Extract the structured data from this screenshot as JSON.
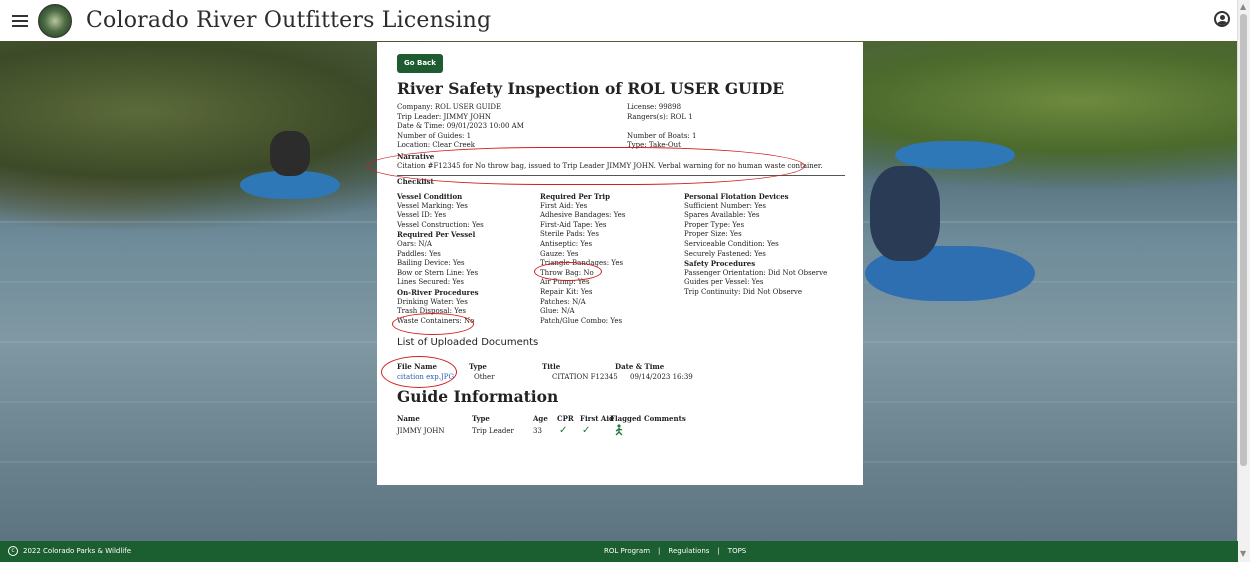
{
  "app": {
    "title": "Colorado River Outfitters Licensing"
  },
  "actions": {
    "go_back": "Go Back"
  },
  "inspection": {
    "title": "River Safety Inspection of ROL USER GUIDE",
    "left_info": [
      "Company: ROL USER GUIDE",
      "Trip Leader: JIMMY JOHN",
      "Date & Time: 09/01/2023 10:00 AM",
      "Number of Guides: 1",
      "Location: Clear Creek"
    ],
    "right_info": [
      "License: 99898",
      "Rangers(s): ROL 1",
      "",
      "Number of Boats: 1",
      "Type: Take-Out"
    ],
    "narrative_label": "Narrative",
    "narrative": "Citation #F12345 for No throw bag, issued to Trip Leader JIMMY JOHN. Verbal warning for no human waste container.",
    "checklist_label": "Checklist"
  },
  "checklist": {
    "col1": [
      {
        "t": "Vessel Condition",
        "b": true
      },
      {
        "t": "Vessel Marking: Yes"
      },
      {
        "t": "Vessel ID: Yes"
      },
      {
        "t": "Vessel Construction: Yes"
      },
      {
        "t": "Required Per Vessel",
        "b": true
      },
      {
        "t": "Oars: N/A"
      },
      {
        "t": "Paddles: Yes"
      },
      {
        "t": "Bailing Device: Yes"
      },
      {
        "t": "Bow or Stern Line: Yes"
      },
      {
        "t": "Lines Secured: Yes"
      },
      {
        "t": "On-River Procedures",
        "b": true
      },
      {
        "t": "Drinking Water: Yes"
      },
      {
        "t": "Trash Disposal: Yes"
      },
      {
        "t": "Waste Containers: No"
      }
    ],
    "col2": [
      {
        "t": "Required Per Trip",
        "b": true
      },
      {
        "t": "First Aid: Yes"
      },
      {
        "t": "Adhesive Bandages: Yes"
      },
      {
        "t": "First-Aid Tape: Yes"
      },
      {
        "t": "Sterile Pads: Yes"
      },
      {
        "t": "Antiseptic: Yes"
      },
      {
        "t": "Gauze: Yes"
      },
      {
        "t": "Triangle Bandages: Yes"
      },
      {
        "t": "Throw Bag: No"
      },
      {
        "t": "Air Pump: Yes"
      },
      {
        "t": "Repair Kit: Yes"
      },
      {
        "t": "Patches: N/A"
      },
      {
        "t": "Glue: N/A"
      },
      {
        "t": "Patch/Glue Combo: Yes"
      }
    ],
    "col3": [
      {
        "t": "Personal Flotation Devices",
        "b": true
      },
      {
        "t": "Sufficient Number: Yes"
      },
      {
        "t": "Spares Available: Yes"
      },
      {
        "t": "Proper Type: Yes"
      },
      {
        "t": "Proper Size: Yes"
      },
      {
        "t": "Serviceable Condition: Yes"
      },
      {
        "t": "Securely Fastened: Yes"
      },
      {
        "t": "Safety Procedures",
        "b": true
      },
      {
        "t": "Passenger Orientation: Did Not Observe"
      },
      {
        "t": "Guides per Vessel: Yes"
      },
      {
        "t": "Trip Continuity: Did Not Observe"
      }
    ]
  },
  "documents": {
    "title": "List of Uploaded Documents",
    "headers": [
      "File Name",
      "Type",
      "Title",
      "Date & Time"
    ],
    "rows": [
      {
        "file": "citation exp.JPG",
        "type": "Other",
        "title": "CITATION F12345",
        "date": "09/14/2023 16:39"
      }
    ]
  },
  "guides": {
    "title": "Guide Information",
    "headers": [
      "Name",
      "Type",
      "Age",
      "CPR",
      "First Aid",
      "Flagged",
      "Comments"
    ],
    "rows": [
      {
        "name": "JIMMY JOHN",
        "type": "Trip Leader",
        "age": "33",
        "cpr": "✓",
        "first_aid": "✓",
        "flagged_icon": "flag-person-icon"
      }
    ]
  },
  "footer": {
    "copyright": "2022 Colorado Parks & Wildlife",
    "links": [
      "ROL Program",
      "Regulations",
      "TOPS"
    ]
  },
  "colors": {
    "brand_green": "#1b5e30",
    "annotation_red": "#d21f1f"
  }
}
